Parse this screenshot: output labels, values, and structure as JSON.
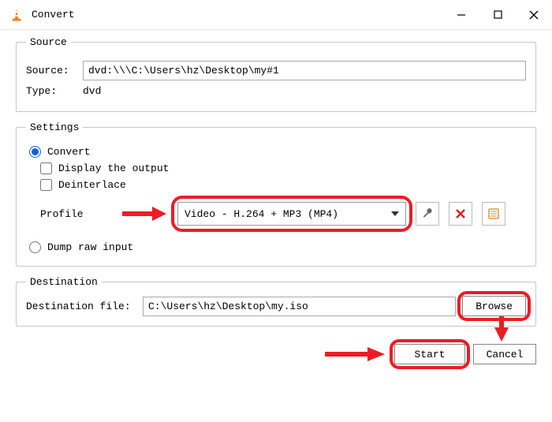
{
  "window": {
    "title": "Convert"
  },
  "source": {
    "legend": "Source",
    "source_label": "Source:",
    "source_value": "dvd:\\\\\\C:\\Users\\hz\\Desktop\\my#1",
    "type_label": "Type:",
    "type_value": "dvd"
  },
  "settings": {
    "legend": "Settings",
    "convert_label": "Convert",
    "display_output_label": "Display the output",
    "deinterlace_label": "Deinterlace",
    "profile_label": "Profile",
    "profile_value": "Video - H.264 + MP3 (MP4)",
    "dump_raw_label": "Dump raw input"
  },
  "destination": {
    "legend": "Destination",
    "file_label": "Destination file:",
    "file_value": "C:\\Users\\hz\\Desktop\\my.iso",
    "browse_label": "Browse"
  },
  "buttons": {
    "start": "Start",
    "cancel": "Cancel"
  }
}
